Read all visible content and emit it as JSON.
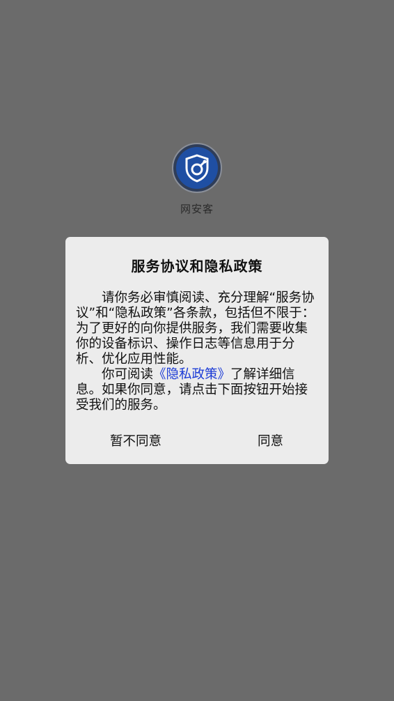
{
  "app": {
    "name": "网安客",
    "logo_icon": "shield-logo-icon",
    "logo_color": "#1f4fa3"
  },
  "dialog": {
    "title": "服务协议和隐私政策",
    "paragraph1": "请你务必审慎阅读、充分理解“服务协议”和“隐私政策”各条款，包括但不限于：为了更好的向你提供服务，我们需要收集你的设备标识、操作日志等信息用于分析、优化应用性能。",
    "paragraph2_before": "你可阅读",
    "privacy_link": "《隐私政策》",
    "paragraph2_after": "了解详细信息。如果你同意，请点击下面按钮开始接受我们的服务。",
    "decline_label": "暂不同意",
    "accept_label": "同意"
  },
  "colors": {
    "overlay": "#6b6b6b",
    "dialog_background": "#ececec",
    "link": "#1b3bd6"
  }
}
